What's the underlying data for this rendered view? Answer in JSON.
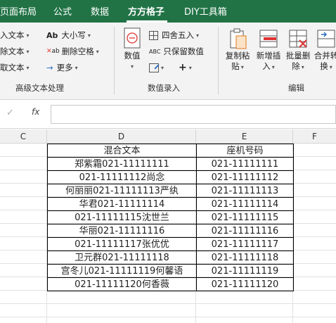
{
  "tabs": [
    "页面布局",
    "公式",
    "数据",
    "方方格子",
    "DIY工具箱"
  ],
  "ribbon": {
    "text_group": {
      "items": [
        "入文本",
        "除文本",
        "取文本"
      ],
      "label": "高级文本处理"
    },
    "format_items": [
      "大小写",
      "删除空格",
      "更多"
    ],
    "value_group": {
      "big_button": "数值",
      "round": "四舍五入",
      "keep_value": "只保留数值",
      "label": "数值录入"
    },
    "edit_group": {
      "copy_paste": [
        "复制粘",
        "贴"
      ],
      "insert": [
        "新增插",
        "入"
      ],
      "batch_delete": [
        "批量删",
        "除"
      ],
      "merge": [
        "合并转",
        "换"
      ],
      "label": "编辑"
    }
  },
  "formula_bar": {
    "fx": "fx",
    "cancel": "✓",
    "value": ""
  },
  "columns": [
    "C",
    "D",
    "E",
    "F"
  ],
  "table": {
    "headers": [
      "混合文本",
      "座机号码"
    ],
    "rows": [
      [
        "郑紫霜021-11111111",
        "021-11111111"
      ],
      [
        "021-11111112尚念",
        "021-11111112"
      ],
      [
        "何丽丽021-11111113严纨",
        "021-11111113"
      ],
      [
        "华君021-11111114",
        "021-11111114"
      ],
      [
        "021-11111115沈世兰",
        "021-11111115"
      ],
      [
        "华丽021-11111116",
        "021-11111116"
      ],
      [
        "021-11111117张优优",
        "021-11111117"
      ],
      [
        "卫元群021-11111118",
        "021-11111118"
      ],
      [
        "宫冬儿021-11111119何馨语",
        "021-11111119"
      ],
      [
        "021-11111120何香薇",
        "021-11111120"
      ]
    ]
  }
}
